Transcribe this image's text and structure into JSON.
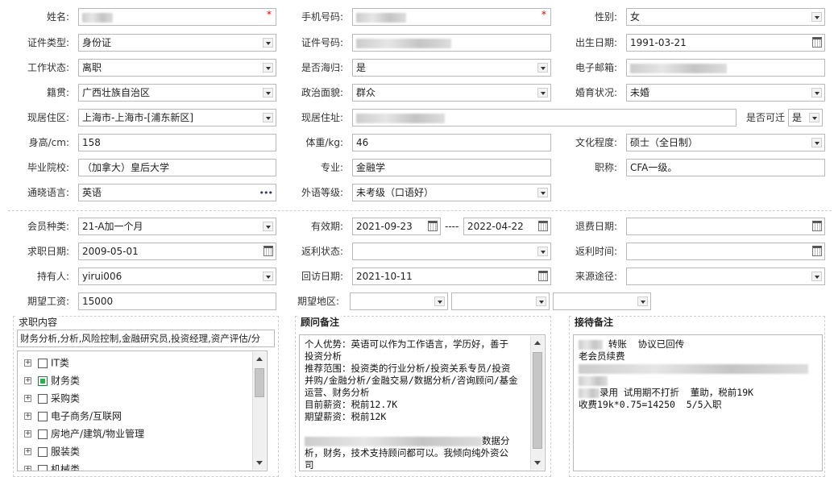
{
  "profile": {
    "name_label": "姓名:",
    "phone_label": "手机号码:",
    "gender_label": "性别:",
    "gender_value": "女",
    "id_type_label": "证件类型:",
    "id_type_value": "身份证",
    "id_no_label": "证件号码:",
    "birth_label": "出生日期:",
    "birth_value": "1991-03-21",
    "work_status_label": "工作状态:",
    "work_status_value": "离职",
    "overseas_label": "是否海归:",
    "overseas_value": "是",
    "email_label": "电子邮箱:",
    "native_label": "籍贯:",
    "native_value": "广西壮族自治区",
    "political_label": "政治面貌:",
    "political_value": "群众",
    "marital_label": "婚育状况:",
    "marital_value": "未婚",
    "district_label": "现居住区:",
    "district_value": "上海市-上海市-[浦东新区]",
    "address_label": "现居住址:",
    "relocate_label": "是否可迁",
    "relocate_value": "是",
    "height_label": "身高/cm:",
    "height_value": "158",
    "weight_label": "体重/kg:",
    "weight_value": "46",
    "education_label": "文化程度:",
    "education_value": "硕士（全日制）",
    "school_label": "毕业院校:",
    "school_value": "（加拿大）皇后大学",
    "major_label": "专业:",
    "major_value": "金融学",
    "title_label": "职称:",
    "title_value": "CFA一级。",
    "language_label": "通晓语言:",
    "language_value": "英语",
    "lang_level_label": "外语等级:",
    "lang_level_value": "未考级（口语好）",
    "required_mark": "*"
  },
  "membership": {
    "type_label": "会员种类:",
    "type_value": "21-A加一个月",
    "valid_label": "有效期:",
    "valid_from": "2021-09-23",
    "valid_sep": "----",
    "valid_to": "2022-04-22",
    "refund_date_label": "退费日期:",
    "job_date_label": "求职日期:",
    "job_date_value": "2009-05-01",
    "rebate_status_label": "返利状态:",
    "rebate_time_label": "返利时间:",
    "holder_label": "持有人:",
    "holder_value": "yirui006",
    "visit_label": "回访日期:",
    "visit_value": "2021-10-11",
    "source_label": "来源途径:",
    "salary_label": "期望工资:",
    "salary_value": "15000",
    "region_label": "期望地区:"
  },
  "job_panel": {
    "title": "求职内容",
    "summary": "财务分析,分析,风险控制,金融研究员,投资经理,资产评估/分",
    "tree": [
      {
        "label": "IT类",
        "checked": false
      },
      {
        "label": "财务类",
        "checked": true
      },
      {
        "label": "采购类",
        "checked": false
      },
      {
        "label": "电子商务/互联网",
        "checked": false
      },
      {
        "label": "房地产/建筑/物业管理",
        "checked": false
      },
      {
        "label": "服装类",
        "checked": false
      },
      {
        "label": "机械类",
        "checked": false
      }
    ]
  },
  "advisor_panel": {
    "title": "顾问备注",
    "line1": "个人优势：英语可以作为工作语言，学历好，善于\n投资分析\n推荐范围：投资类的行业分析/投资关系专员/投资\n并购/金融分析/金融交易/数据分析/咨询顾问/基金\n运营、财务分析\n目前薪资：税前12.7K\n期望薪资：税前12K",
    "line2_tail": "数据分",
    "line3": "析，财务，技术支持顾问都可以。我倾向纯外资公\n司"
  },
  "reception_panel": {
    "title": "接待备注",
    "line1_tail": " 转账  协议已回传",
    "line2": "老会员续费",
    "line5_tail": "录用 试用期不打折  董助，税前19K",
    "line6": "收费19k*0.75=14250  5/5入职"
  }
}
